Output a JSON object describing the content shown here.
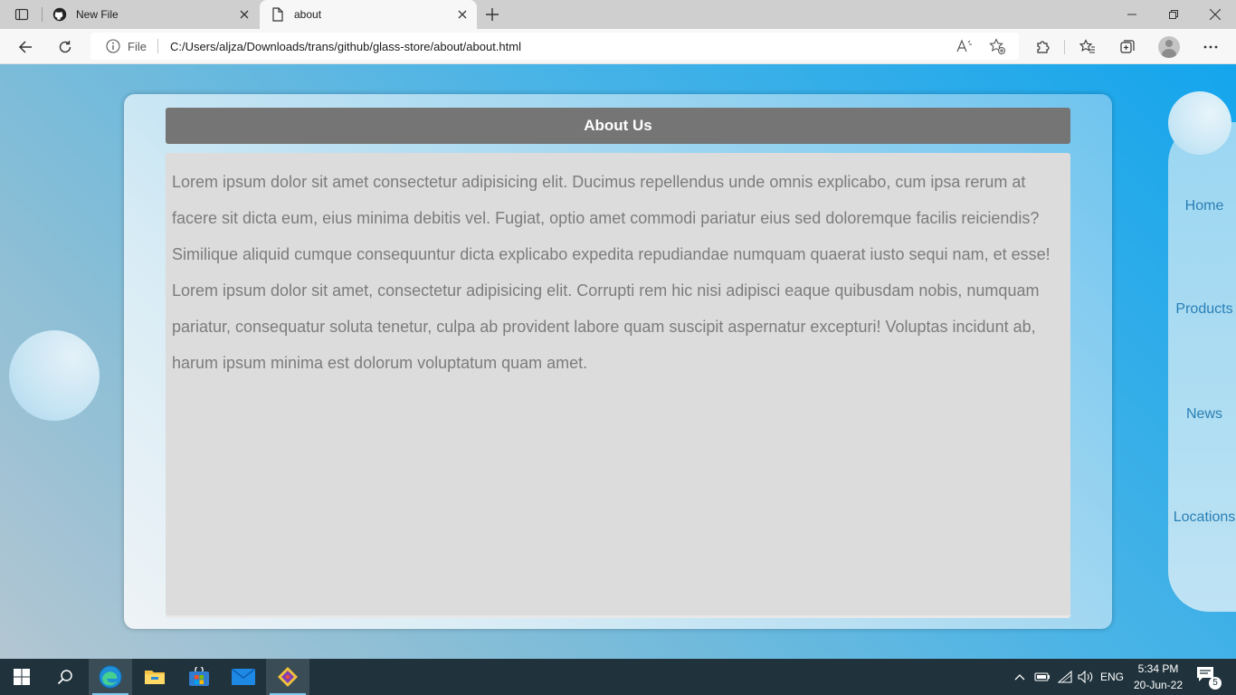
{
  "browser": {
    "tabs": [
      {
        "title": "New File",
        "icon": "github-icon",
        "active": false
      },
      {
        "title": "about",
        "icon": "page-icon",
        "active": true
      }
    ],
    "address": {
      "scheme_label": "File",
      "url": "C:/Users/aljza/Downloads/trans/github/glass-store/about/about.html"
    }
  },
  "page": {
    "header": "About Us",
    "content": "Lorem ipsum dolor sit amet consectetur adipisicing elit. Ducimus repellendus unde omnis explicabo, cum ipsa rerum at facere sit dicta eum, eius minima debitis vel. Fugiat, optio amet commodi pariatur eius sed doloremque facilis reiciendis? Similique aliquid cumque consequuntur dicta explicabo expedita repudiandae numquam quaerat iusto sequi nam, et esse! Lorem ipsum dolor sit amet, consectetur adipisicing elit. Corrupti rem hic nisi adipisci eaque quibusdam nobis, numquam pariatur, consequatur soluta tenetur, culpa ab provident labore quam suscipit aspernatur excepturi! Voluptas incidunt ab, harum ipsum minima est dolorum voluptatum quam amet.",
    "nav": [
      "Home",
      "Products",
      "News",
      "Locations"
    ]
  },
  "taskbar": {
    "apps": [
      "windows-start-icon",
      "search-icon",
      "edge-icon",
      "file-explorer-icon",
      "store-icon",
      "mail-icon",
      "git-icon"
    ],
    "language": "ENG",
    "time": "5:34 PM",
    "date": "20-Jun-22",
    "notification_count": "5"
  },
  "colors": {
    "header_bar": "#757575",
    "content_bg": "#dcdcdc",
    "content_text": "#7c7c7c",
    "nav_link": "#2a7fb5",
    "taskbar": "#20333c"
  }
}
